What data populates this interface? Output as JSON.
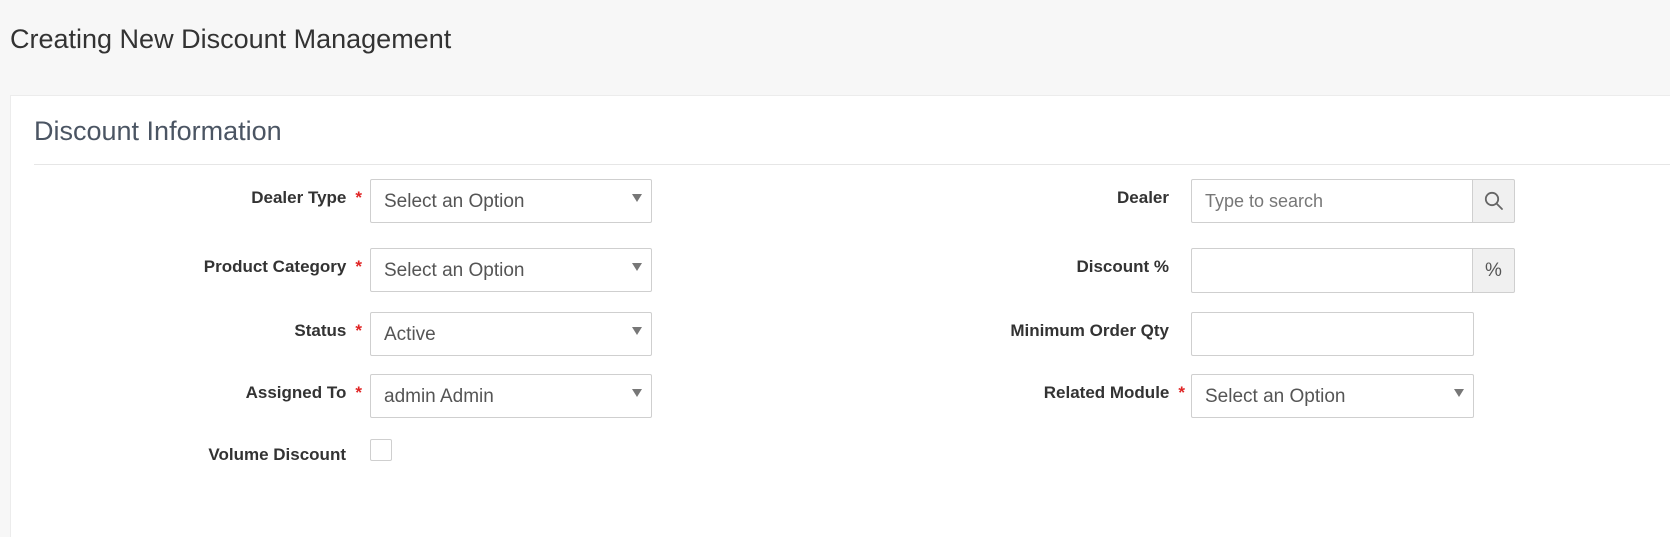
{
  "page_title": "Creating New Discount Management",
  "section_title": "Discount Information",
  "left_fields": {
    "dealer_type": {
      "label": "Dealer Type",
      "required": "*",
      "value": "Select an Option"
    },
    "product_category": {
      "label": "Product Category",
      "required": "*",
      "value": "Select an Option"
    },
    "status": {
      "label": "Status",
      "required": "*",
      "value": "Active"
    },
    "assigned_to": {
      "label": "Assigned To",
      "required": "*",
      "value": "admin Admin"
    },
    "volume_discount": {
      "label": "Volume Discount"
    }
  },
  "right_fields": {
    "dealer": {
      "label": "Dealer",
      "placeholder": "Type to search",
      "icon": "search-icon"
    },
    "discount_percent": {
      "label": "Discount %",
      "value": "",
      "addon": "%"
    },
    "minimum_order_qty": {
      "label": "Minimum Order Qty",
      "value": ""
    },
    "related_module": {
      "label": "Related Module",
      "required": "*",
      "value": "Select an Option"
    }
  },
  "colors": {
    "required": "#e02424",
    "border": "#cfcfcf",
    "addon_bg": "#f0f0f0"
  }
}
